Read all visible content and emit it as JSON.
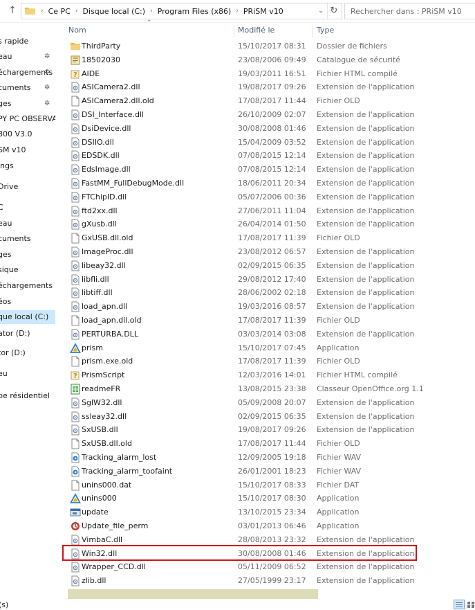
{
  "address": {
    "crumbs": [
      "Ce PC",
      "Disque local (C:)",
      "Program Files (x86)",
      "PRiSM v10"
    ]
  },
  "search": {
    "placeholder": "Rechercher dans : PRiSM v10"
  },
  "columns": {
    "name": "Nom",
    "modified": "Modifié le",
    "type": "Type"
  },
  "sidebar": [
    {
      "label": "s rapide",
      "pinned": false
    },
    {
      "label": "eau",
      "pinned": true
    },
    {
      "label": "échargements",
      "pinned": true
    },
    {
      "label": "cuments",
      "pinned": true
    },
    {
      "label": "ges",
      "pinned": true
    },
    {
      "label": "PY PC OBSERVAT",
      "pinned": false
    },
    {
      "label": "800 V3.0",
      "pinned": false
    },
    {
      "label": "SM v10",
      "pinned": false
    },
    {
      "label": "ings",
      "pinned": false
    },
    {
      "label": "Drive",
      "pinned": false
    },
    {
      "label": "C",
      "pinned": false
    },
    {
      "label": "eau",
      "pinned": false
    },
    {
      "label": "cuments",
      "pinned": false
    },
    {
      "label": "ges",
      "pinned": false
    },
    {
      "label": "sique",
      "pinned": false
    },
    {
      "label": "échargements",
      "pinned": false
    },
    {
      "label": "éos",
      "pinned": false
    },
    {
      "label": "que local (C:)",
      "pinned": false,
      "selected": true
    },
    {
      "label": "ator (D:)",
      "pinned": false
    },
    {
      "label": "tor (D:)",
      "pinned": false
    },
    {
      "label": "eu",
      "pinned": false
    },
    {
      "label": "pe résidentiel",
      "pinned": false
    }
  ],
  "files": [
    {
      "name": "ThirdParty",
      "date": "15/10/2017 08:31",
      "type": "Dossier de fichiers",
      "icon": "folder-icon"
    },
    {
      "name": "18502030",
      "date": "23/08/2006 09:49",
      "type": "Catalogue de sécurité",
      "icon": "security-catalog-icon"
    },
    {
      "name": "AIDE",
      "date": "19/03/2011 16:51",
      "type": "Fichier HTML compilé",
      "icon": "help-file-icon"
    },
    {
      "name": "ASICamera2.dll",
      "date": "19/08/2017 09:26",
      "type": "Extension de l'application",
      "icon": "dll-icon"
    },
    {
      "name": "ASICamera2.dll.old",
      "date": "17/08/2017 11:44",
      "type": "Fichier OLD",
      "icon": "file-icon"
    },
    {
      "name": "DSI_Interface.dll",
      "date": "26/10/2009 02:07",
      "type": "Extension de l'application",
      "icon": "dll-icon"
    },
    {
      "name": "DsiDevice.dll",
      "date": "30/08/2008 01:46",
      "type": "Extension de l'application",
      "icon": "dll-icon"
    },
    {
      "name": "DSIIO.dll",
      "date": "15/04/2009 03:52",
      "type": "Extension de l'application",
      "icon": "dll-icon"
    },
    {
      "name": "EDSDK.dll",
      "date": "07/08/2015 12:14",
      "type": "Extension de l'application",
      "icon": "dll-icon"
    },
    {
      "name": "EdsImage.dll",
      "date": "07/08/2015 12:14",
      "type": "Extension de l'application",
      "icon": "dll-icon"
    },
    {
      "name": "FastMM_FullDebugMode.dll",
      "date": "18/06/2011 20:34",
      "type": "Extension de l'application",
      "icon": "dll-icon"
    },
    {
      "name": "FTChipID.dll",
      "date": "05/07/2006 00:36",
      "type": "Extension de l'application",
      "icon": "dll-icon"
    },
    {
      "name": "ftd2xx.dll",
      "date": "27/06/2011 11:04",
      "type": "Extension de l'application",
      "icon": "dll-icon"
    },
    {
      "name": "gXusb.dll",
      "date": "26/04/2014 01:50",
      "type": "Extension de l'application",
      "icon": "dll-icon"
    },
    {
      "name": "GxUSB.dll.old",
      "date": "17/08/2017 11:39",
      "type": "Fichier OLD",
      "icon": "file-icon"
    },
    {
      "name": "ImageProc.dll",
      "date": "23/08/2012 06:57",
      "type": "Extension de l'application",
      "icon": "dll-icon"
    },
    {
      "name": "libeay32.dll",
      "date": "02/09/2015 06:35",
      "type": "Extension de l'application",
      "icon": "dll-icon"
    },
    {
      "name": "libfli.dll",
      "date": "29/08/2012 17:40",
      "type": "Extension de l'application",
      "icon": "dll-icon"
    },
    {
      "name": "libtiff.dll",
      "date": "28/06/2002 02:18",
      "type": "Extension de l'application",
      "icon": "dll-icon"
    },
    {
      "name": "load_apn.dll",
      "date": "19/03/2016 08:57",
      "type": "Extension de l'application",
      "icon": "dll-icon"
    },
    {
      "name": "load_apn.dll.old",
      "date": "17/08/2017 11:39",
      "type": "Fichier OLD",
      "icon": "file-icon"
    },
    {
      "name": "PERTURBA.DLL",
      "date": "03/03/2014 03:08",
      "type": "Extension de l'application",
      "icon": "dll-icon"
    },
    {
      "name": "prism",
      "date": "15/10/2017 07:45",
      "type": "Application",
      "icon": "prism-app-icon"
    },
    {
      "name": "prism.exe.old",
      "date": "17/08/2017 11:39",
      "type": "Fichier OLD",
      "icon": "file-icon"
    },
    {
      "name": "PrismScript",
      "date": "12/03/2016 14:01",
      "type": "Fichier HTML compilé",
      "icon": "help-file-icon"
    },
    {
      "name": "readmeFR",
      "date": "13/08/2015 23:38",
      "type": "Classeur OpenOffice.org 1.1",
      "icon": "spreadsheet-icon"
    },
    {
      "name": "SglW32.dll",
      "date": "05/09/2008 20:07",
      "type": "Extension de l'application",
      "icon": "dll-icon"
    },
    {
      "name": "ssleay32.dll",
      "date": "02/09/2015 06:35",
      "type": "Extension de l'application",
      "icon": "dll-icon"
    },
    {
      "name": "SxUSB.dll",
      "date": "19/08/2017 09:26",
      "type": "Extension de l'application",
      "icon": "dll-icon"
    },
    {
      "name": "SxUSB.dll.old",
      "date": "17/08/2017 11:44",
      "type": "Fichier OLD",
      "icon": "file-icon"
    },
    {
      "name": "Tracking_alarm_lost",
      "date": "12/09/2005 19:18",
      "type": "Fichier WAV",
      "icon": "audio-file-icon"
    },
    {
      "name": "Tracking_alarm_toofaint",
      "date": "26/01/2001 18:23",
      "type": "Fichier WAV",
      "icon": "audio-file-icon"
    },
    {
      "name": "unins000.dat",
      "date": "15/10/2017 08:33",
      "type": "Fichier DAT",
      "icon": "file-icon"
    },
    {
      "name": "unins000",
      "date": "15/10/2017 08:30",
      "type": "Application",
      "icon": "prism-app-icon"
    },
    {
      "name": "update",
      "date": "13/10/2015 23:34",
      "type": "Application",
      "icon": "update-app-icon"
    },
    {
      "name": "Update_file_perm",
      "date": "03/01/2013 06:46",
      "type": "Application",
      "icon": "update-perm-app-icon"
    },
    {
      "name": "VimbaC.dll",
      "date": "28/08/2013 23:32",
      "type": "Extension de l'application",
      "icon": "dll-icon"
    },
    {
      "name": "Win32.dll",
      "date": "30/08/2008 01:46",
      "type": "Extension de l'application",
      "icon": "dll-icon",
      "highlighted": true
    },
    {
      "name": "Wrapper_CCD.dll",
      "date": "05/11/2009 06:52",
      "type": "Extension de l'application",
      "icon": "dll-icon"
    },
    {
      "name": "zlib.dll",
      "date": "27/05/1999 23:17",
      "type": "Extension de l'application",
      "icon": "dll-icon"
    }
  ],
  "status": {
    "text": "(s)"
  },
  "colors": {
    "highlight_border": "#d0111b",
    "selected_bg": "#cce8ff",
    "header_text": "#4c607a",
    "scrollbar": "#dedbb8"
  }
}
